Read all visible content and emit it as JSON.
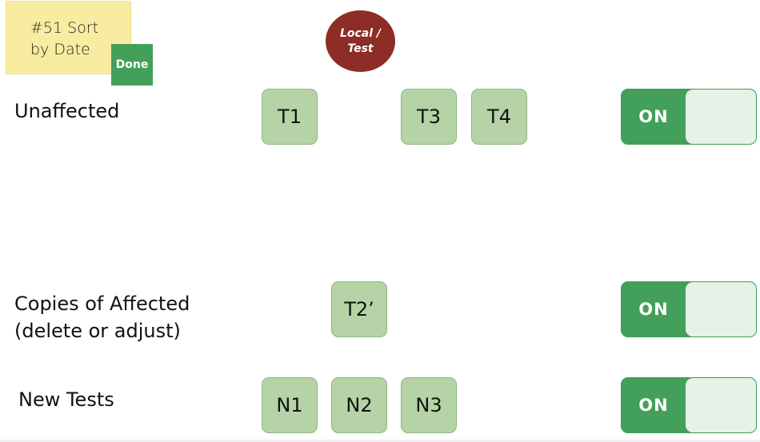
{
  "sticky_note": {
    "line1": "#51 Sort",
    "line2": "by Date",
    "status": "Done"
  },
  "environment_badge": {
    "line1": "Local /",
    "line2": "Test"
  },
  "rows": [
    {
      "label_line1": "Unaffected",
      "label_line2": "",
      "tiles": [
        "T1",
        "T3",
        "T4"
      ],
      "toggle": "ON"
    },
    {
      "label_line1": "Copies of Affected",
      "label_line2": "(delete or adjust)",
      "tiles": [
        "T2’"
      ],
      "toggle": "ON"
    },
    {
      "label_line1": "New Tests",
      "label_line2": "",
      "tiles": [
        "N1",
        "N2",
        "N3"
      ],
      "toggle": "ON"
    }
  ],
  "colors": {
    "sticky": "#f8eca0",
    "done": "#43a05a",
    "badge": "#8e2c26",
    "tile": "#b5d3a6",
    "toggle_on": "#43a05a",
    "toggle_knob": "#e6f1e7"
  }
}
